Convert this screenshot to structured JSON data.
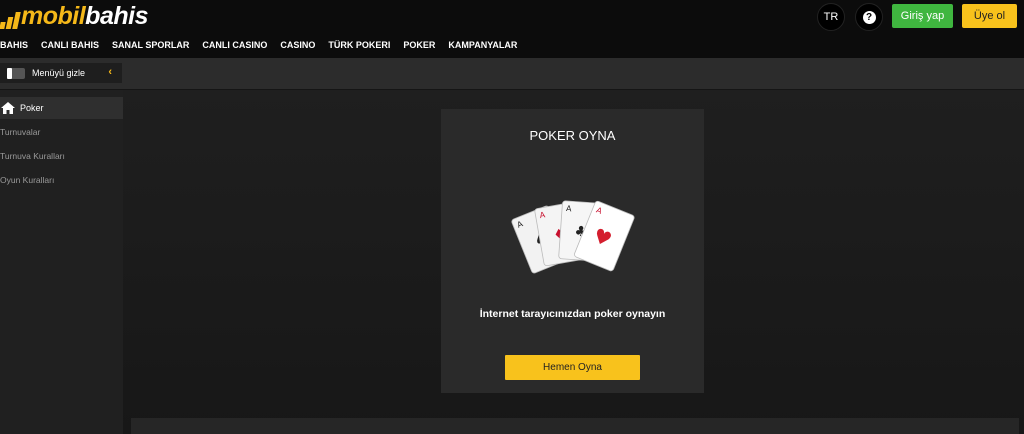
{
  "header": {
    "logo": {
      "part1": "mobil",
      "part2": "bahis"
    },
    "language": "TR",
    "help_icon": "question-mark-icon",
    "login_label": "Giriş yap",
    "register_label": "Üye ol",
    "nav": [
      "BAHIS",
      "CANLI BAHIS",
      "SANAL SPORLAR",
      "CANLI CASINO",
      "CASINO",
      "TÜRK POKERI",
      "POKER",
      "KAMPANYALAR"
    ]
  },
  "menubar": {
    "toggle_label": "Menüyü gizle",
    "chevron_icon": "chevron-left-icon"
  },
  "sidebar": {
    "active": {
      "icon": "home-icon",
      "label": "Poker"
    },
    "items": [
      "Turnuvalar",
      "Turnuva Kuralları",
      "Oyun Kuralları"
    ]
  },
  "main": {
    "title": "POKER OYNA",
    "illustration_icon": "playing-cards-icon",
    "description": "İnternet tarayıcınızdan poker oynayın",
    "play_label": "Hemen Oyna"
  },
  "colors": {
    "accent": "#f8c21c",
    "login": "#3fb63f",
    "background": "#1b1b1b"
  }
}
